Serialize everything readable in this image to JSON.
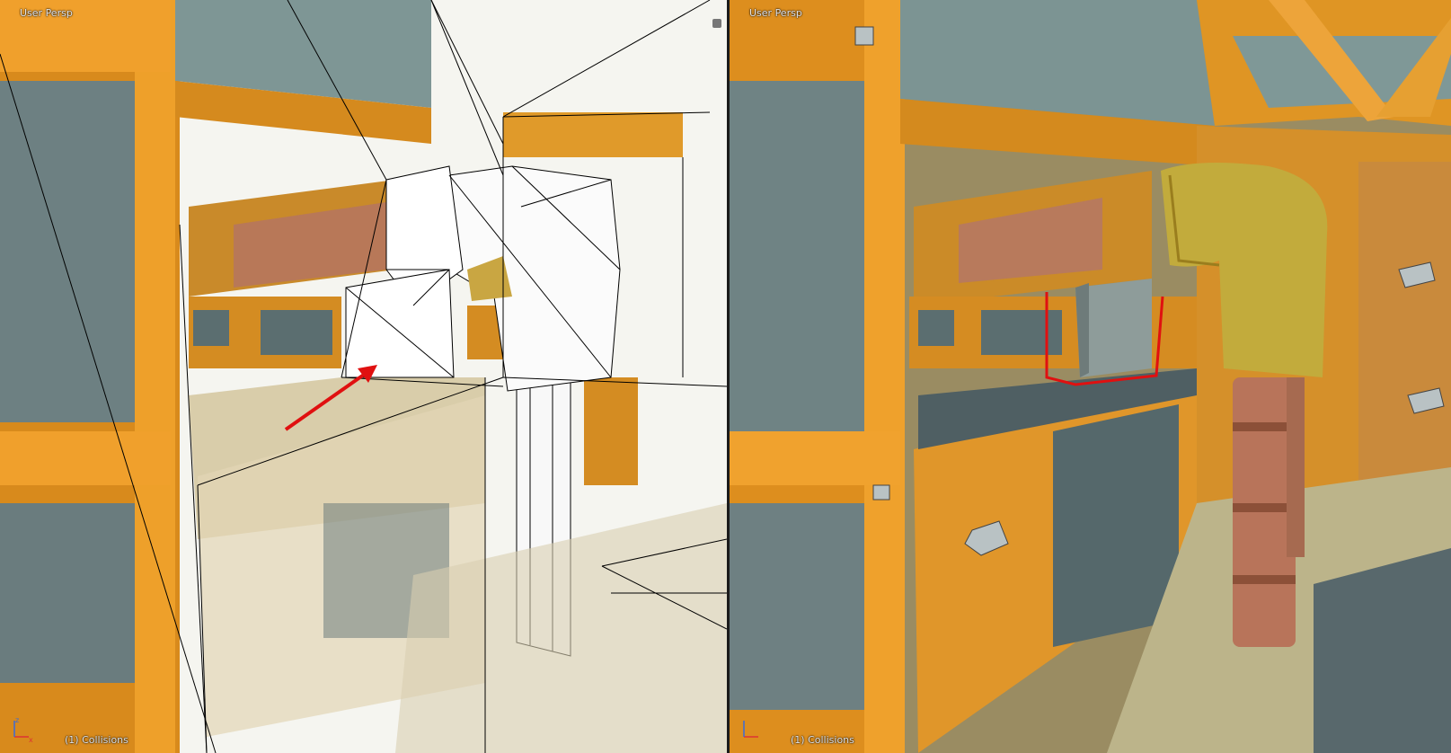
{
  "viewports": {
    "left": {
      "perspective_label": "User Persp",
      "object_label": "(1) Collisions",
      "shading": "wireframe-overlay"
    },
    "right": {
      "perspective_label": "User Persp",
      "object_label": "(1) Collisions",
      "shading": "textured"
    }
  },
  "axis_gizmo": {
    "x": "x",
    "z": "z"
  },
  "colors": {
    "wood": "#e3931c",
    "wood_dark": "#b56a10",
    "metal": "#8fa3a2",
    "metal_dark": "#5c6e70",
    "copper": "#b8745a",
    "brass": "#c9b23a",
    "floor": "#bdb58a",
    "annotation_red": "#e01010",
    "wire": "#000000"
  },
  "icons": {
    "annotation": "red-arrow",
    "highlight": "red-outline-box"
  }
}
